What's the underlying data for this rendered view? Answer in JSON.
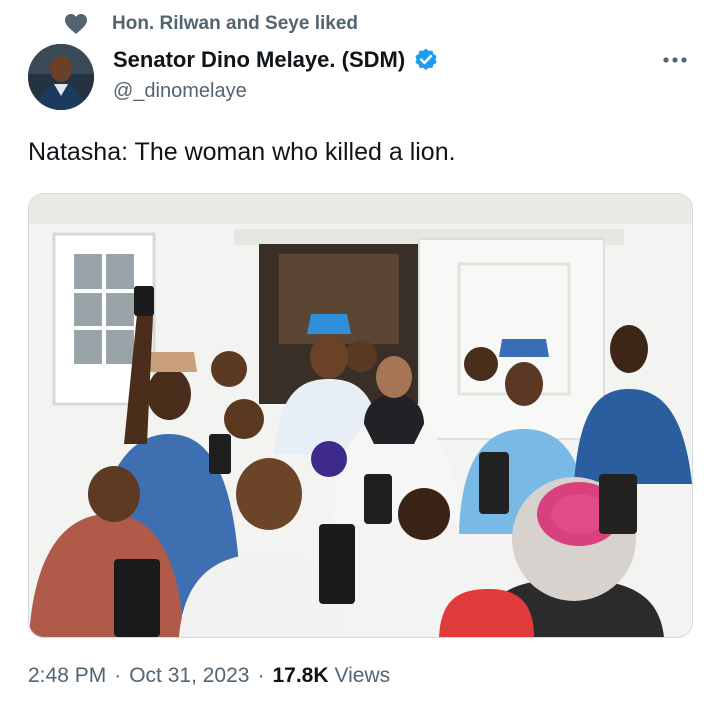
{
  "social_context": {
    "text": "Hon. Rilwan and Seye liked",
    "icon": "heart-icon"
  },
  "author": {
    "display_name": "Senator Dino Melaye. (SDM)",
    "handle": "@_dinomelaye",
    "verified": true,
    "verified_color": "#1d9bf0"
  },
  "tweet": {
    "text": "Natasha: The woman who killed a lion."
  },
  "meta": {
    "time": "2:48 PM",
    "separator": "·",
    "date": "Oct 31, 2023",
    "views_count": "17.8K",
    "views_label": "Views"
  },
  "colors": {
    "primary_text": "#0f1419",
    "secondary_text": "#536471",
    "accent": "#1d9bf0"
  }
}
